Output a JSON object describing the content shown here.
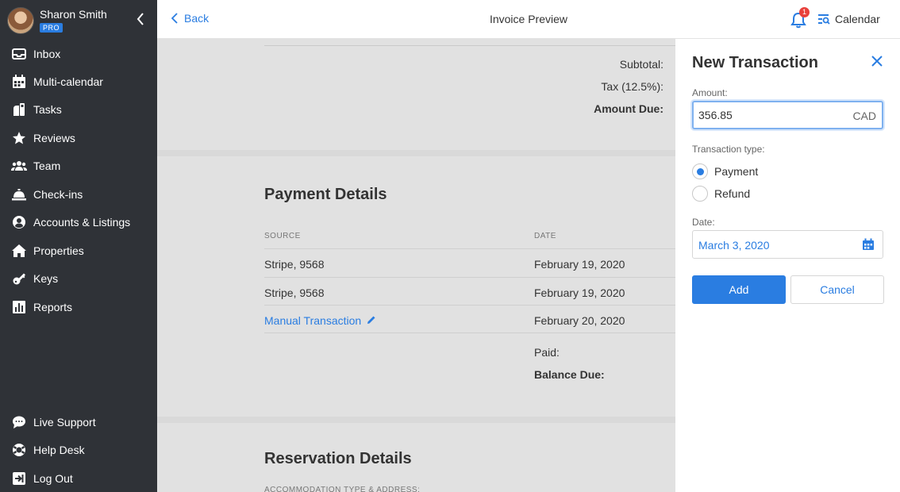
{
  "user": {
    "name": "Sharon Smith",
    "badge": "PRO"
  },
  "sidebar": {
    "items": [
      {
        "label": "Inbox",
        "icon": "inbox-icon"
      },
      {
        "label": "Multi-calendar",
        "icon": "calendar-grid-icon"
      },
      {
        "label": "Tasks",
        "icon": "tasks-icon"
      },
      {
        "label": "Reviews",
        "icon": "star-icon"
      },
      {
        "label": "Team",
        "icon": "team-icon"
      },
      {
        "label": "Check-ins",
        "icon": "bell-desk-icon"
      },
      {
        "label": "Accounts & Listings",
        "icon": "user-circle-icon"
      },
      {
        "label": "Properties",
        "icon": "home-icon"
      },
      {
        "label": "Keys",
        "icon": "key-icon"
      },
      {
        "label": "Reports",
        "icon": "chart-icon"
      }
    ],
    "bottom": [
      {
        "label": "Live Support",
        "icon": "chat-icon"
      },
      {
        "label": "Help Desk",
        "icon": "lifebuoy-icon"
      },
      {
        "label": "Log Out",
        "icon": "logout-icon"
      }
    ]
  },
  "topbar": {
    "back_label": "Back",
    "title": "Invoice Preview",
    "notification_count": "1",
    "calendar_label": "Calendar"
  },
  "invoice": {
    "subtotal_label": "Subtotal:",
    "tax_label": "Tax (12.5%):",
    "amount_due_label": "Amount Due:",
    "payment_section": {
      "title": "Payment Details",
      "columns": {
        "source": "SOURCE",
        "date": "DATE"
      },
      "rows": [
        {
          "source": "Stripe, 9568",
          "date": "February 19, 2020"
        },
        {
          "source": "Stripe, 9568",
          "date": "February 19, 2020"
        },
        {
          "source": "Manual Transaction",
          "date": "February 20, 2020"
        }
      ],
      "paid_label": "Paid:",
      "balance_label": "Balance Due:"
    },
    "reservation_section": {
      "title": "Reservation Details",
      "accommodation_label": "ACCOMMODATION TYPE & ADDRESS:"
    }
  },
  "panel": {
    "title": "New Transaction",
    "amount_label": "Amount:",
    "amount_value": "356.85",
    "currency": "CAD",
    "type_label": "Transaction type:",
    "types": [
      {
        "label": "Payment",
        "selected": true
      },
      {
        "label": "Refund",
        "selected": false
      }
    ],
    "date_label": "Date:",
    "date_value": "March 3, 2020",
    "add_label": "Add",
    "cancel_label": "Cancel"
  },
  "colors": {
    "accent": "#2a7de1",
    "sidebar": "#2f3237",
    "badge": "#e8413c"
  }
}
